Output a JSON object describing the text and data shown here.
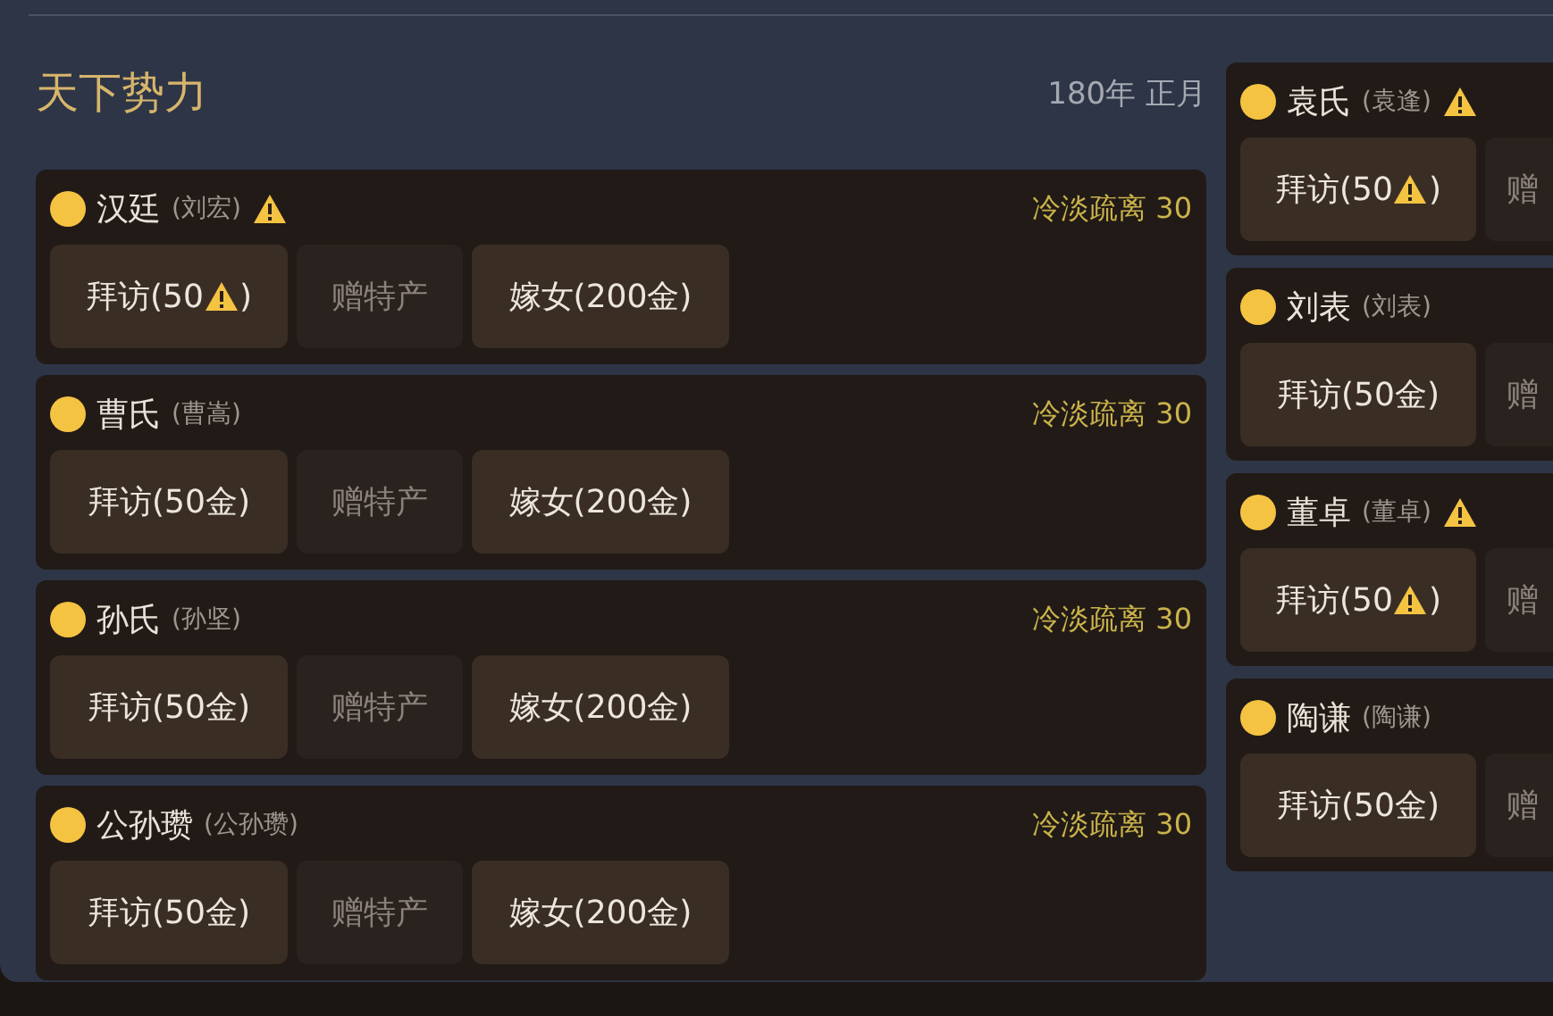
{
  "title": "天下势力",
  "date": "180年 正月",
  "factions": [
    {
      "name": "汉廷",
      "ruler": "(刘宏)",
      "warning": true,
      "relation": "冷淡疏离 30",
      "buttons": [
        {
          "text": "拜访(50",
          "warning": true,
          "text_after": ")",
          "disabled": false
        },
        {
          "text": "赠特产",
          "warning": false,
          "disabled": true
        },
        {
          "text": "嫁女(200金)",
          "warning": false,
          "disabled": false
        }
      ]
    },
    {
      "name": "曹氏",
      "ruler": "(曹嵩)",
      "warning": false,
      "relation": "冷淡疏离 30",
      "buttons": [
        {
          "text": "拜访(50金)",
          "warning": false,
          "disabled": false
        },
        {
          "text": "赠特产",
          "warning": false,
          "disabled": true
        },
        {
          "text": "嫁女(200金)",
          "warning": false,
          "disabled": false
        }
      ]
    },
    {
      "name": "孙氏",
      "ruler": "(孙坚)",
      "warning": false,
      "relation": "冷淡疏离 30",
      "buttons": [
        {
          "text": "拜访(50金)",
          "warning": false,
          "disabled": false
        },
        {
          "text": "赠特产",
          "warning": false,
          "disabled": true
        },
        {
          "text": "嫁女(200金)",
          "warning": false,
          "disabled": false
        }
      ]
    },
    {
      "name": "公孙瓒",
      "ruler": "(公孙瓒)",
      "warning": false,
      "relation": "冷淡疏离 30",
      "buttons": [
        {
          "text": "拜访(50金)",
          "warning": false,
          "disabled": false
        },
        {
          "text": "赠特产",
          "warning": false,
          "disabled": true
        },
        {
          "text": "嫁女(200金)",
          "warning": false,
          "disabled": false
        }
      ]
    }
  ],
  "factions_right": [
    {
      "name": "袁氏",
      "ruler": "(袁逢)",
      "warning": true,
      "buttons": [
        {
          "text": "拜访(50",
          "warning": true,
          "text_after": ")",
          "disabled": false
        },
        {
          "text": "赠",
          "warning": false,
          "disabled": true
        }
      ]
    },
    {
      "name": "刘表",
      "ruler": "(刘表)",
      "warning": false,
      "buttons": [
        {
          "text": "拜访(50金)",
          "warning": false,
          "disabled": false
        },
        {
          "text": "赠",
          "warning": false,
          "disabled": true
        }
      ]
    },
    {
      "name": "董卓",
      "ruler": "(董卓)",
      "warning": true,
      "buttons": [
        {
          "text": "拜访(50",
          "warning": true,
          "text_after": ")",
          "disabled": false
        },
        {
          "text": "赠",
          "warning": false,
          "disabled": true
        }
      ]
    },
    {
      "name": "陶谦",
      "ruler": "(陶谦)",
      "warning": false,
      "buttons": [
        {
          "text": "拜访(50金)",
          "warning": false,
          "disabled": false
        },
        {
          "text": "赠",
          "warning": false,
          "disabled": true
        }
      ]
    }
  ]
}
